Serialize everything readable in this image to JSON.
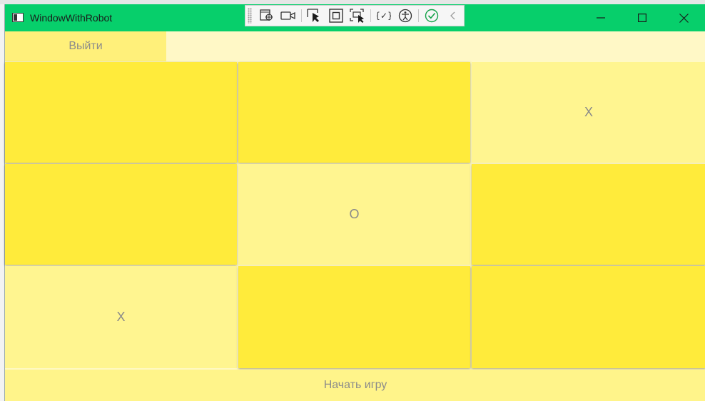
{
  "window": {
    "title": "WindowWithRobot",
    "accent": "#07cf6b"
  },
  "toolbar": {
    "icons": [
      "select-element-icon",
      "record-video-icon",
      "pointer-select-icon",
      "layout-adorner-icon",
      "track-focus-icon",
      "binding-failures-icon",
      "accessibility-icon",
      "check-icon",
      "collapse-icon"
    ]
  },
  "controls": {
    "exit_label": "Выйти",
    "start_label": "Начать игру"
  },
  "board": {
    "cells": [
      {
        "row": 1,
        "col": 1,
        "mark": ""
      },
      {
        "row": 1,
        "col": 2,
        "mark": ""
      },
      {
        "row": 1,
        "col": 3,
        "mark": "X"
      },
      {
        "row": 2,
        "col": 1,
        "mark": ""
      },
      {
        "row": 2,
        "col": 2,
        "mark": "O"
      },
      {
        "row": 2,
        "col": 3,
        "mark": ""
      },
      {
        "row": 3,
        "col": 1,
        "mark": "X"
      },
      {
        "row": 3,
        "col": 2,
        "mark": ""
      },
      {
        "row": 3,
        "col": 3,
        "mark": ""
      }
    ],
    "empty_color": "#ffeb3b",
    "filled_color": "#fff590"
  }
}
